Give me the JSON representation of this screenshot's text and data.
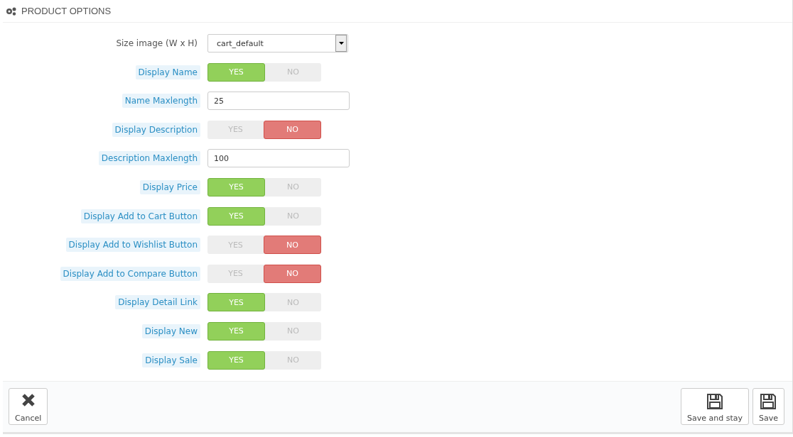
{
  "panel": {
    "title": "PRODUCT OPTIONS"
  },
  "fields": [
    {
      "kind": "select",
      "label": "Size image (W x H)",
      "help": false,
      "value": "cart_default"
    },
    {
      "kind": "switch",
      "label": "Display Name",
      "help": true,
      "yes": "YES",
      "no": "NO",
      "on": true
    },
    {
      "kind": "text",
      "label": "Name Maxlength",
      "help": true,
      "value": "25"
    },
    {
      "kind": "switch",
      "label": "Display Description",
      "help": true,
      "yes": "YES",
      "no": "NO",
      "on": false
    },
    {
      "kind": "text",
      "label": "Description Maxlength",
      "help": true,
      "value": "100"
    },
    {
      "kind": "switch",
      "label": "Display Price",
      "help": true,
      "yes": "YES",
      "no": "NO",
      "on": true
    },
    {
      "kind": "switch",
      "label": "Display Add to Cart Button",
      "help": true,
      "yes": "YES",
      "no": "NO",
      "on": true
    },
    {
      "kind": "switch",
      "label": "Display Add to Wishlist Button",
      "help": true,
      "yes": "YES",
      "no": "NO",
      "on": false
    },
    {
      "kind": "switch",
      "label": "Display Add to Compare Button",
      "help": true,
      "yes": "YES",
      "no": "NO",
      "on": false
    },
    {
      "kind": "switch",
      "label": "Display Detail Link",
      "help": true,
      "yes": "YES",
      "no": "NO",
      "on": true
    },
    {
      "kind": "switch",
      "label": "Display New",
      "help": true,
      "yes": "YES",
      "no": "NO",
      "on": true
    },
    {
      "kind": "switch",
      "label": "Display Sale",
      "help": true,
      "yes": "YES",
      "no": "NO",
      "on": true
    }
  ],
  "footer": {
    "cancel": "Cancel",
    "buttons": [
      "Save and stay",
      "Save"
    ]
  }
}
